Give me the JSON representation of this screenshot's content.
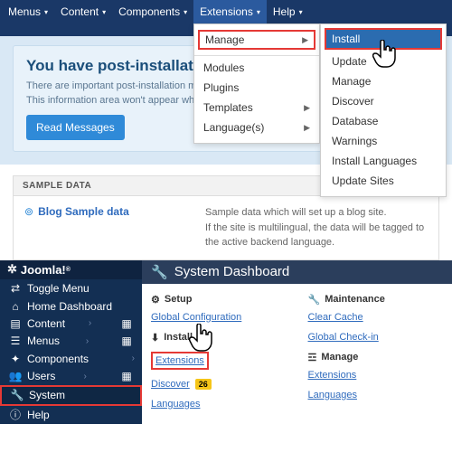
{
  "topnav": {
    "items": [
      "Menus",
      "Content",
      "Components",
      "Extensions",
      "Help"
    ],
    "active": "Extensions"
  },
  "dd_extensions": {
    "manage": "Manage",
    "items": [
      "Modules",
      "Plugins",
      "Templates",
      "Language(s)"
    ]
  },
  "dd_manage": {
    "selected": "Install",
    "items": [
      "Update",
      "Manage",
      "Discover",
      "Database",
      "Warnings",
      "Install Languages",
      "Update Sites"
    ]
  },
  "notice": {
    "title": "You have post-installation",
    "line1": "There are important post-installation m",
    "line2": "This information area won't appear when you have hidden all the m",
    "button": "Read Messages"
  },
  "sample": {
    "header": "SAMPLE DATA",
    "link": "Blog Sample data",
    "desc1": "Sample data which will set up a blog site.",
    "desc2": "If the site is multilingual, the data will be tagged to the active backend language."
  },
  "j4": {
    "brand": "Joomla!",
    "side": [
      {
        "icon": "⇄",
        "label": "Toggle Menu"
      },
      {
        "icon": "⌂",
        "label": "Home Dashboard"
      },
      {
        "icon": "≡",
        "label": "Content",
        "sub": true
      },
      {
        "icon": "☰",
        "label": "Menus",
        "sub": true
      },
      {
        "icon": "✦",
        "label": "Components",
        "sub": true
      },
      {
        "icon": "👥",
        "label": "Users",
        "sub": true
      },
      {
        "icon": "✔",
        "label": "System",
        "system": true
      },
      {
        "icon": "ⓘ",
        "label": "Help"
      }
    ],
    "title": "System Dashboard",
    "setup": {
      "header": "Setup",
      "links": [
        "Global Configuration"
      ]
    },
    "install": {
      "header": "Install",
      "ext": "Extensions",
      "discover": "Discover",
      "discover_badge": "26",
      "lang": "Languages"
    },
    "maintenance": {
      "header": "Maintenance",
      "links": [
        "Clear Cache",
        "Global Check-in"
      ]
    },
    "manage": {
      "header": "Manage",
      "links": [
        "Extensions",
        "Languages"
      ]
    }
  }
}
